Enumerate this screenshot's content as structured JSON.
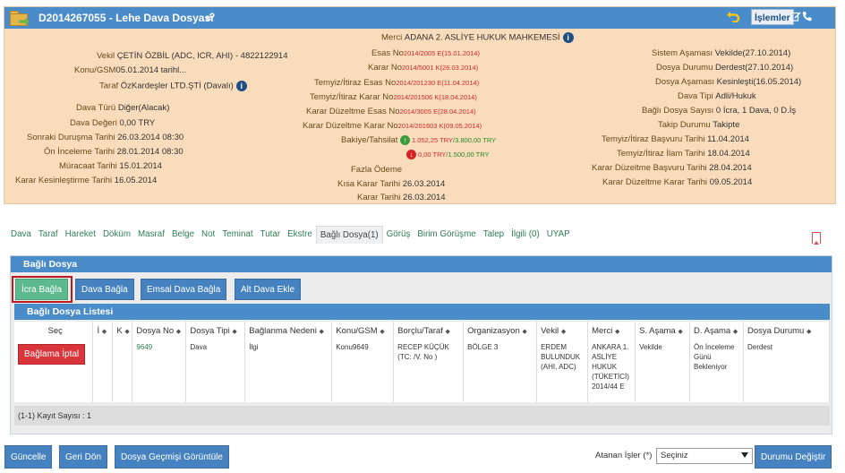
{
  "case": {
    "title": "D2014267055 - Lehe Dava Dosyası",
    "islemler": "İşlemler"
  },
  "left_fields": [
    {
      "label": "Vekil",
      "value": "ÇETİN ÖZBİL (ADC, ICR, AHI) - 4822122914"
    },
    {
      "label": "Konu/GSM",
      "value": "05.01.2014 tarihl..."
    },
    {
      "label": "Taraf",
      "value": "ÖzKardeşler LTD.ŞTİ  (Davalı)"
    },
    {
      "label": "Dava Türü",
      "value": "Diğer(Alacak)"
    },
    {
      "label": "Dava Değeri",
      "value": "0,00 TRY"
    },
    {
      "label": "Sonraki Duruşma Tarihi",
      "value": "26.03.2014 08:30"
    },
    {
      "label": "Ön İnceleme Tarihi",
      "value": "28.01.2014 08:30"
    },
    {
      "label": "Müracaat Tarihi",
      "value": "15.01.2014"
    },
    {
      "label": "Karar Kesinleştirme Tarihi",
      "value": "16.05.2014"
    }
  ],
  "mid_fields": [
    {
      "label": "Merci",
      "value": "ADANA 2. ASLİYE HUKUK MAHKEMESİ"
    },
    {
      "label": "Esas No",
      "value": "2014/2005 E(15.01.2014)"
    },
    {
      "label": "Karar No",
      "value": "2014/5001 K(26.03.2014)"
    },
    {
      "label": "Temyiz/İtiraz Esas No",
      "value": "2014/201230 E(11.04.2014)"
    },
    {
      "label": "Temyiz/İtiraz Karar No",
      "value": "2014/201506 K(18.04.2014)"
    },
    {
      "label": "Karar Düzeltme Esas No",
      "value": "2014/3005 E(28.04.2014)"
    },
    {
      "label": "Karar Düzeltme Karar No",
      "value": "2014/201603 K(09.05.2014)"
    },
    {
      "label": "Bakiye/Tahsilat",
      "value1": "1.052,25 TRY",
      "sep1": "/",
      "value2": "3.800,00 TRY",
      "value3": "0,00 TRY",
      "sep2": "/",
      "value4": "1.500,00 TRY"
    },
    {
      "label": "Fazla Ödeme",
      "value": ""
    },
    {
      "label": "Kısa Karar Tarihi",
      "value": "26.03.2014"
    },
    {
      "label": "Karar Tarihi",
      "value": "26.03.2014"
    }
  ],
  "right_fields": [
    {
      "label": "Sistem Aşaması",
      "value": "Vekilde(27.10.2014)"
    },
    {
      "label": "Dosya Durumu",
      "value": "Derdest(27.10.2014)"
    },
    {
      "label": "Dosya Aşaması",
      "value": "Kesinleşti(16.05.2014)"
    },
    {
      "label": "Dava Tipi",
      "value": "Adli/Hukuk"
    },
    {
      "label": "Bağlı Dosya Sayısı",
      "value": "0 İcra, 1 Dava, 0 D.İş"
    },
    {
      "label": "Takip Durumu",
      "value": "Takipte"
    },
    {
      "label": "Temyiz/İtiraz Başvuru Tarihi",
      "value": "11.04.2014"
    },
    {
      "label": "Temyiz/İtiraz İlam Tarihi",
      "value": "18.04.2014"
    },
    {
      "label": "Karar Düzeltme Başvuru Tarihi",
      "value": "28.04.2014"
    },
    {
      "label": "Karar Düzeltme Karar Tarihi",
      "value": "09.05.2014"
    }
  ],
  "tabs": [
    "Dava",
    "Taraf",
    "Hareket",
    "Döküm",
    "Masraf",
    "Belge",
    "Not",
    "Teminat",
    "Tutar",
    "Ekstre",
    "Bağlı Dosya(1)",
    "Görüş",
    "Birim Görüşme",
    "Talep",
    "İlgili (0)",
    "UYAP"
  ],
  "active_tab": "Bağlı Dosya(1)",
  "bagli_dosya": {
    "title": "Bağlı Dosya",
    "buttons": [
      "İcra Bağla",
      "Dava Bağla",
      "Emsal Dava Bağla",
      "Alt Dava Ekle"
    ],
    "list_title": "Bağlı Dosya Listesi",
    "columns": [
      "Seç",
      "İ",
      "K",
      "Dosya No",
      "Dosya Tipi",
      "Bağlanma Nedeni",
      "Konu/GSM",
      "Borçlu/Taraf",
      "Organizasyon",
      "Vekil",
      "Merci",
      "S. Aşama",
      "D. Aşama",
      "Dosya Durumu"
    ],
    "row": {
      "action": "Bağlama İptal",
      "dosya_no": "9649",
      "dosya_tipi": "Dava",
      "baglanma_nedeni": "İlgi",
      "konu": "Konu9649",
      "borclu": "RECEP KÜÇÜK (TC: /V. No )",
      "organizasyon": "BÖLGE 3",
      "vekil": "ERDEM BULUNDUK (AHI, ADC)",
      "merci": "ANKARA 1. ASLİYE HUKUK (TÜKETİCİ) 2014/44 E",
      "s_asama": "Vekilde",
      "d_asama": "Ön İnceleme Günü Bekleniyor",
      "durum": "Derdest"
    },
    "kayit": "(1-1) Kayıt Sayısı : 1"
  },
  "bottom": {
    "buttons": [
      "Güncelle",
      "Geri Dön",
      "Dosya Geçmişi Görüntüle"
    ],
    "atanan_label": "Atanan İşler (*)",
    "select_value": "Seçiniz",
    "durum_button": "Durumu Değiştir"
  },
  "colors": {
    "header_blue": "#4a8cc9",
    "panel_bg": "#f8dcbc",
    "tab_green": "#2f7d55",
    "danger": "#d9353a"
  }
}
